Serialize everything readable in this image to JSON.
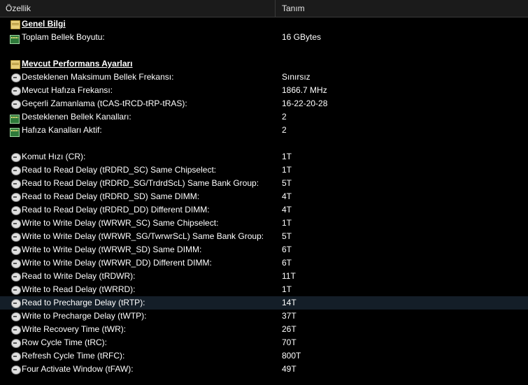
{
  "header": {
    "col_property": "Özellik",
    "col_value": "Tanım"
  },
  "rows": [
    {
      "type": "section",
      "icon": "book-icon",
      "name": "Genel Bilgi",
      "value": ""
    },
    {
      "type": "item",
      "icon": "ram-icon",
      "name": "Toplam Bellek Boyutu:",
      "value": "16 GBytes"
    },
    {
      "type": "blank"
    },
    {
      "type": "section",
      "icon": "book-icon",
      "name": "Mevcut Performans Ayarları",
      "value": ""
    },
    {
      "type": "item",
      "icon": "clock-icon",
      "name": "Desteklenen Maksimum Bellek Frekansı:",
      "value": "Sınırsız"
    },
    {
      "type": "item",
      "icon": "clock-icon",
      "name": "Mevcut Hafıza Frekansı:",
      "value": "1866.7 MHz"
    },
    {
      "type": "item",
      "icon": "clock-icon",
      "name": "Geçerli Zamanlama (tCAS-tRCD-tRP-tRAS):",
      "value": "16-22-20-28"
    },
    {
      "type": "item",
      "icon": "ram-icon",
      "name": "Desteklenen Bellek Kanalları:",
      "value": "2"
    },
    {
      "type": "item",
      "icon": "ram-icon",
      "name": "Hafıza Kanalları Aktif:",
      "value": "2"
    },
    {
      "type": "blank"
    },
    {
      "type": "item",
      "icon": "clock-icon",
      "name": "Komut Hızı (CR):",
      "value": "1T"
    },
    {
      "type": "item",
      "icon": "clock-icon",
      "name": "Read to Read Delay (tRDRD_SC) Same Chipselect:",
      "value": "1T"
    },
    {
      "type": "item",
      "icon": "clock-icon",
      "name": "Read to Read Delay (tRDRD_SG/TrdrdScL) Same Bank Group:",
      "value": "5T"
    },
    {
      "type": "item",
      "icon": "clock-icon",
      "name": "Read to Read Delay (tRDRD_SD) Same DIMM:",
      "value": "4T"
    },
    {
      "type": "item",
      "icon": "clock-icon",
      "name": "Read to Read Delay (tRDRD_DD) Different DIMM:",
      "value": "4T"
    },
    {
      "type": "item",
      "icon": "clock-icon",
      "name": "Write to Write Delay (tWRWR_SC) Same Chipselect:",
      "value": "1T"
    },
    {
      "type": "item",
      "icon": "clock-icon",
      "name": "Write to Write Delay (tWRWR_SG/TwrwrScL) Same Bank Group:",
      "value": "5T"
    },
    {
      "type": "item",
      "icon": "clock-icon",
      "name": "Write to Write Delay (tWRWR_SD) Same DIMM:",
      "value": "6T"
    },
    {
      "type": "item",
      "icon": "clock-icon",
      "name": "Write to Write Delay (tWRWR_DD) Different DIMM:",
      "value": "6T"
    },
    {
      "type": "item",
      "icon": "clock-icon",
      "name": "Read to Write Delay (tRDWR):",
      "value": "11T"
    },
    {
      "type": "item",
      "icon": "clock-icon",
      "name": "Write to Read Delay (tWRRD):",
      "value": "1T"
    },
    {
      "type": "item",
      "icon": "clock-icon",
      "name": "Read to Precharge Delay (tRTP):",
      "value": "14T",
      "highlighted": true
    },
    {
      "type": "item",
      "icon": "clock-icon",
      "name": "Write to Precharge Delay (tWTP):",
      "value": "37T"
    },
    {
      "type": "item",
      "icon": "clock-icon",
      "name": "Write Recovery Time (tWR):",
      "value": "26T"
    },
    {
      "type": "item",
      "icon": "clock-icon",
      "name": "Row Cycle Time (tRC):",
      "value": "70T"
    },
    {
      "type": "item",
      "icon": "clock-icon",
      "name": "Refresh Cycle Time (tRFC):",
      "value": "800T"
    },
    {
      "type": "item",
      "icon": "clock-icon",
      "name": "Four Activate Window (tFAW):",
      "value": "49T"
    }
  ]
}
